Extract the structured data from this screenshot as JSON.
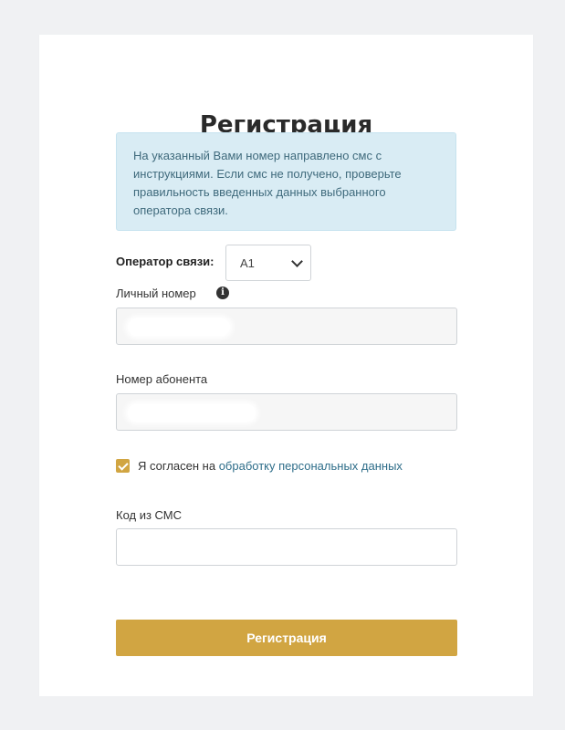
{
  "page": {
    "title": "Регистрация"
  },
  "alert": {
    "text": "На указанный Вами номер направлено смс с инструкциями. Если смс не получено, проверьте правильность введенных данных выбранного оператора связи."
  },
  "operator": {
    "label": "Оператор связи:",
    "selected": "A1"
  },
  "personal_number": {
    "label": "Личный номер",
    "value": ""
  },
  "subscriber_number": {
    "label": "Номер абонента",
    "value": ""
  },
  "consent": {
    "checked": true,
    "prefix": "Я согласен на",
    "link": "обработку персональных данных"
  },
  "sms_code": {
    "label": "Код из СМС",
    "value": ""
  },
  "submit": {
    "label": "Регистрация"
  },
  "colors": {
    "accent": "#d1a542",
    "alert_bg": "#d9ecf4",
    "link": "#2f6e8a",
    "page_bg": "#f0f1f3"
  }
}
